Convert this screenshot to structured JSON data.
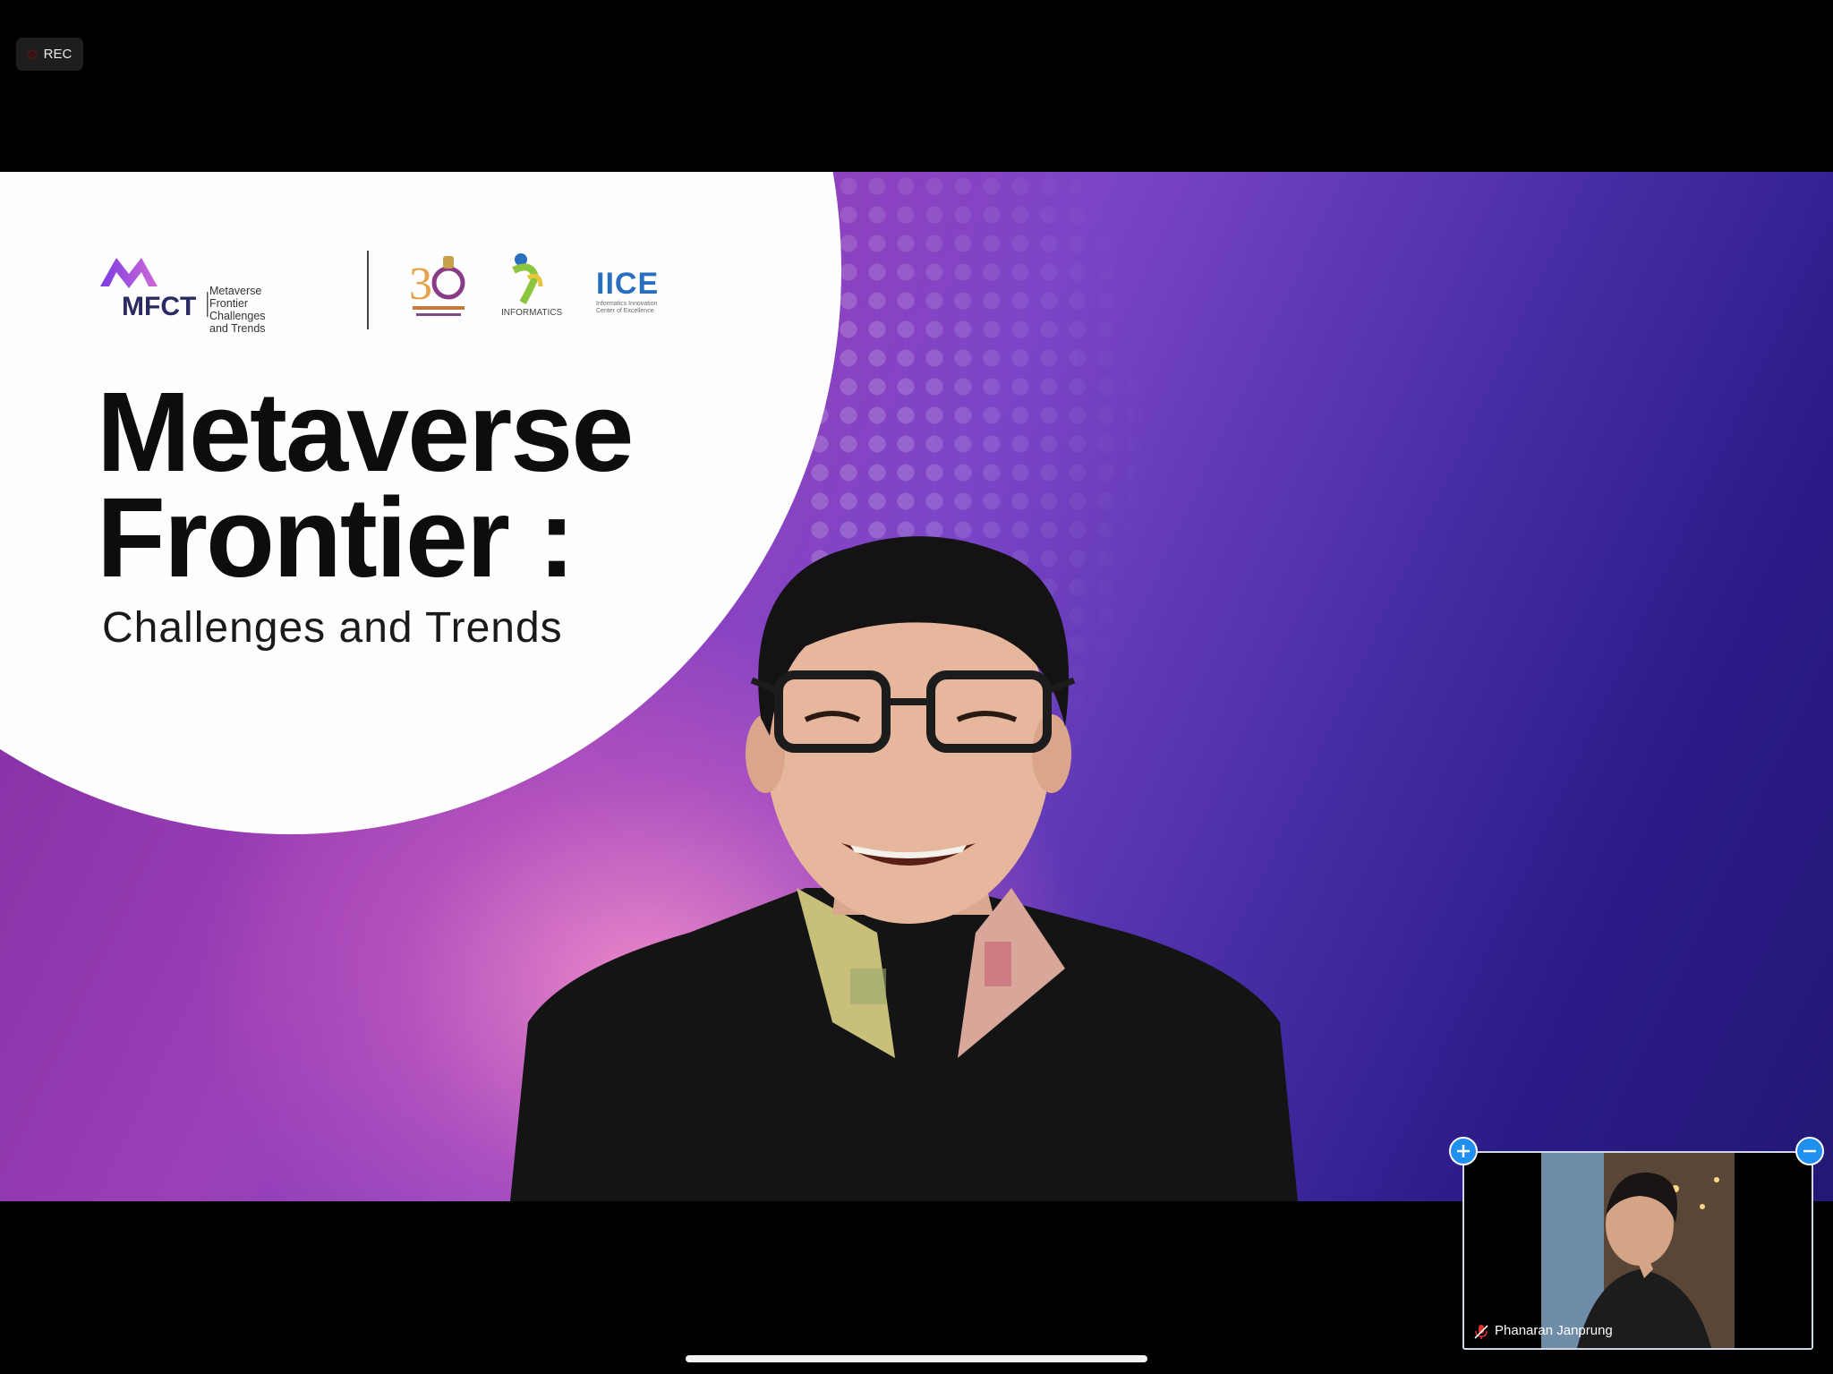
{
  "recording": {
    "label": "REC"
  },
  "presentation": {
    "logo_text": "MFCT",
    "logo_tagline": [
      "Metaverse Frontier",
      "Challenges and Trends"
    ],
    "partner_logo_iice": "IICE",
    "partner_logo_iice_sub": [
      "Informatics Innovation",
      "Center of Excellence"
    ],
    "partner_logo_informatics": "INFORMATICS",
    "title_line1": "Metaverse",
    "title_line2": "Frontier :",
    "subtitle": "Challenges and Trends"
  },
  "self_view": {
    "participant_name": "Phanaran Janprung",
    "mic_state": "muted"
  },
  "colors": {
    "background": "#000000",
    "accent_blue": "#1f8ff0",
    "gradient_purple": "#7c45c8",
    "gradient_pink": "#f08cc8",
    "gradient_navy": "#231876"
  },
  "icons": {
    "rec": "record-dot-icon",
    "mic": "mic-muted-icon",
    "expand": "plus-icon",
    "collapse": "minus-icon"
  }
}
